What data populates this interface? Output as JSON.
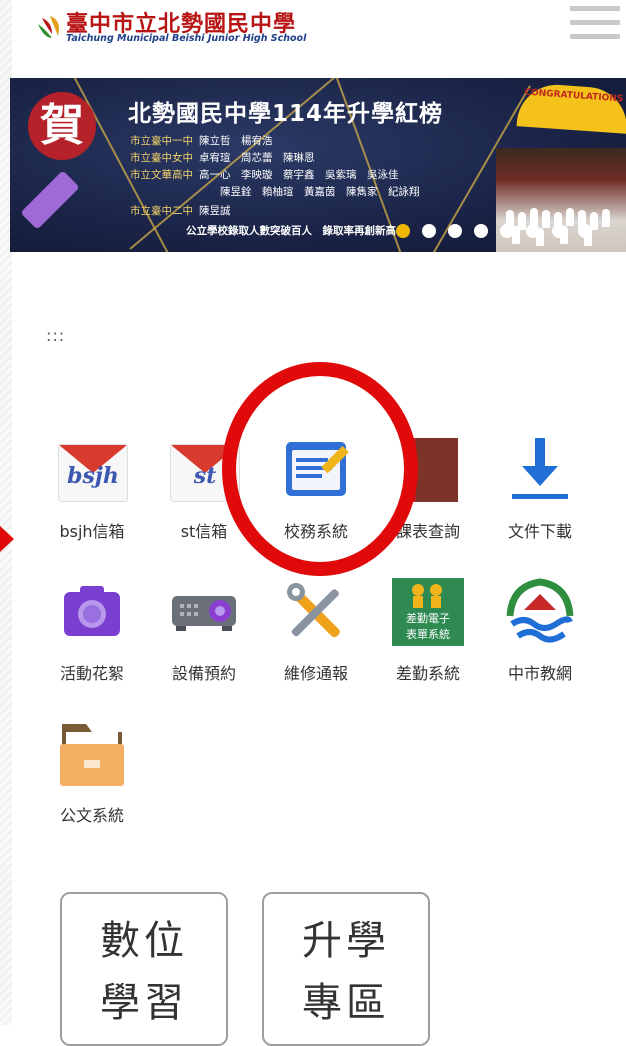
{
  "header": {
    "school_name": "臺中市立北勢國民中學",
    "school_name_en": "Taichung Municipal Beishi Junior High School",
    "menu_icon": "hamburger-menu-icon"
  },
  "banner": {
    "badge": "賀",
    "title": "北勢國民中學114年升學紅榜",
    "congrats": "CONGRATULATIONS",
    "honors": [
      {
        "school": "市立臺中一中",
        "names": "陳立哲　楊宥浩"
      },
      {
        "school": "市立臺中女中",
        "names": "卓宥瑄　周芯蕾　陳琳恩"
      },
      {
        "school": "市立文華高中",
        "names": "高一心　李映璇　蔡宇鑫　吳紫璃　吳泳佳"
      },
      {
        "school": "",
        "names": "陳昱銓　賴柚瑄　黃嘉茵　陳雋家　紀詠翔"
      },
      {
        "school": "市立臺中二中",
        "names": "陳昱誠"
      }
    ],
    "note": "公立學校錄取人數突破百人　錄取率再創新高",
    "carousel_count": 8,
    "carousel_active_index": 0
  },
  "more_label": ":::",
  "apps": [
    {
      "label": "bsjh信箱",
      "icon": "gmail-bsjh-icon",
      "icon_text": "bsjh"
    },
    {
      "label": "st信箱",
      "icon": "gmail-st-icon",
      "icon_text": "st"
    },
    {
      "label": "校務系統",
      "icon": "notepad-pencil-icon"
    },
    {
      "label": "課表查詢",
      "icon": "book-icon"
    },
    {
      "label": "文件下載",
      "icon": "download-icon"
    },
    {
      "label": "活動花絮",
      "icon": "camera-icon"
    },
    {
      "label": "設備預約",
      "icon": "projector-icon"
    },
    {
      "label": "維修通報",
      "icon": "tools-icon"
    },
    {
      "label": "差勤系統",
      "icon": "attendance-icon",
      "icon_text": "差勤電子表單系統"
    },
    {
      "label": "中市教網",
      "icon": "taichung-edu-icon"
    },
    {
      "label": "公文系統",
      "icon": "folder-icon"
    }
  ],
  "cards": [
    {
      "line1": "數位",
      "line2": "學習"
    },
    {
      "line1": "升學",
      "line2": "專區"
    }
  ],
  "colors": {
    "highlight_ring": "#e10a0a",
    "brand_red": "#b81414",
    "banner_bg": "#1a2346"
  }
}
